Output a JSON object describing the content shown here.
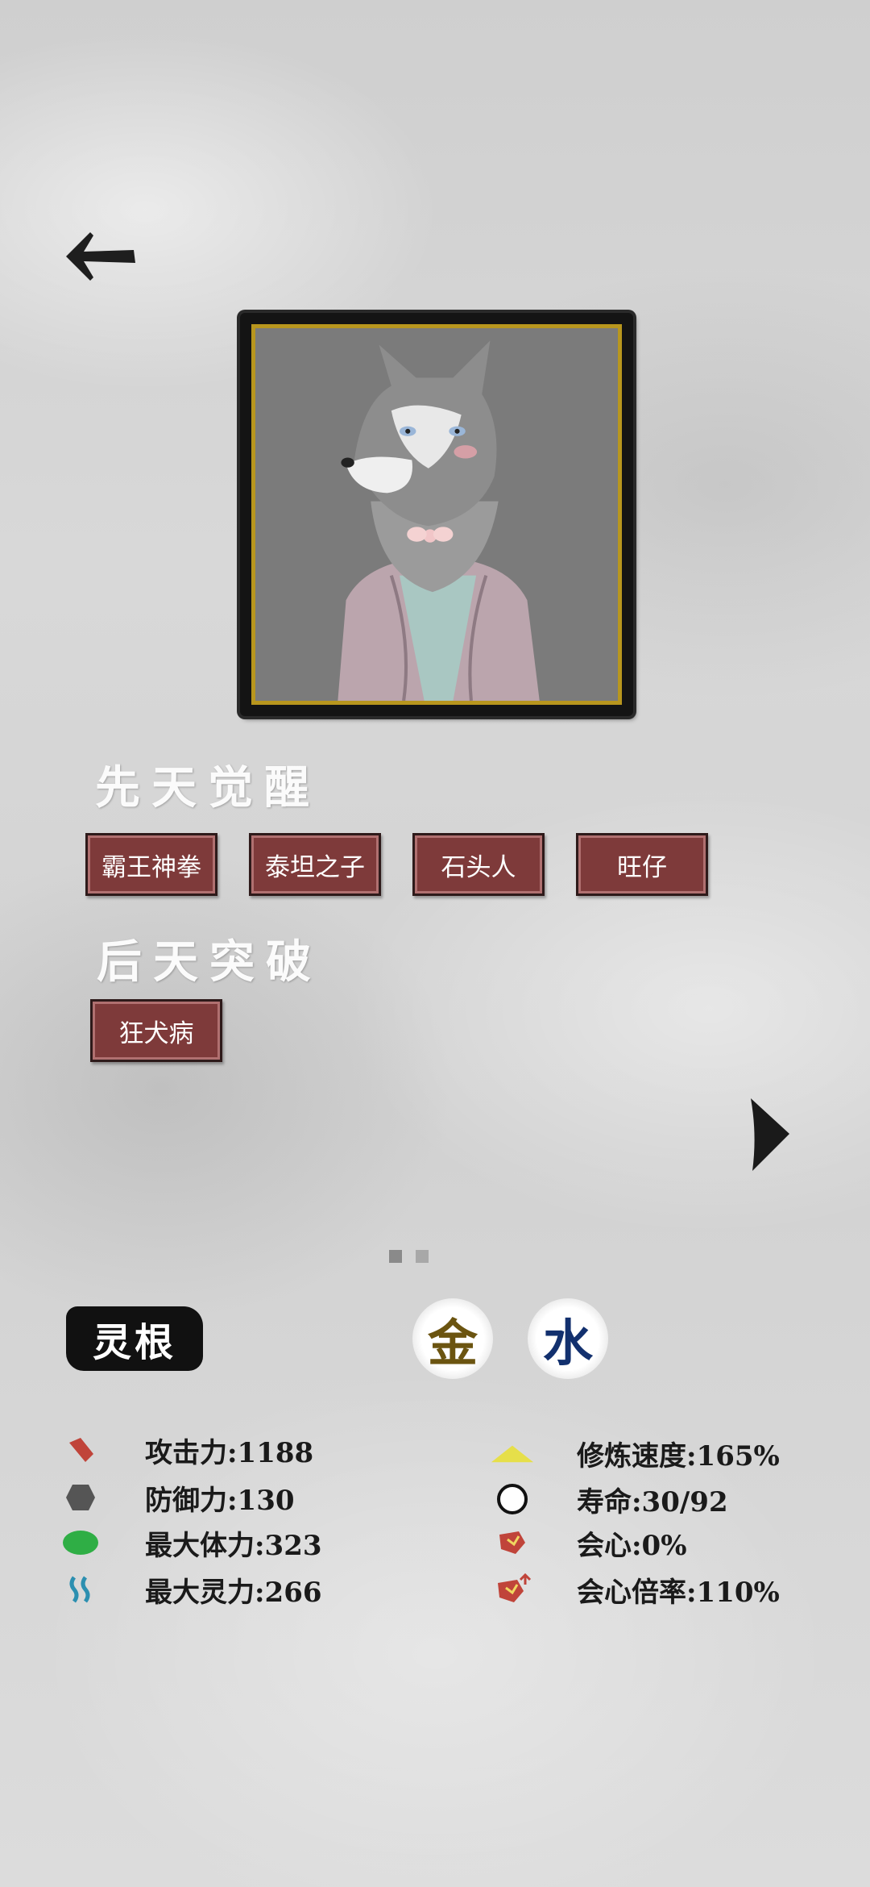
{
  "innate": {
    "title": "先天觉醒",
    "traits": [
      "霸王神拳",
      "泰坦之子",
      "石头人",
      "旺仔"
    ]
  },
  "acquired": {
    "title": "后天突破",
    "traits": [
      "狂犬病"
    ]
  },
  "pager": {
    "count": 2,
    "current": 1
  },
  "spirit_root": {
    "label": "灵根",
    "elements": [
      {
        "char": "金",
        "color": "#6b5410"
      },
      {
        "char": "水",
        "color": "#12306e"
      }
    ]
  },
  "stats_left": [
    {
      "icon": "attack-icon",
      "text": "攻击力:1188"
    },
    {
      "icon": "defense-icon",
      "text": "防御力:130"
    },
    {
      "icon": "hp-icon",
      "text": "最大体力:323"
    },
    {
      "icon": "mana-icon",
      "text": "最大灵力:266"
    }
  ],
  "stats_right": [
    {
      "icon": "cultivation-speed-icon",
      "text": "修炼速度:165%"
    },
    {
      "icon": "lifespan-icon",
      "text": "寿命:30/92"
    },
    {
      "icon": "crit-icon",
      "text": "会心:0%"
    },
    {
      "icon": "crit-multiplier-icon",
      "text": "会心倍率:110%"
    }
  ],
  "colors": {
    "trait_bg": "#7e3a3a",
    "frame_gold": "#b8961e",
    "attack": "#c0443a",
    "hp": "#2fae45",
    "mana": "#2c8fb0",
    "speed": "#e6df4a"
  }
}
